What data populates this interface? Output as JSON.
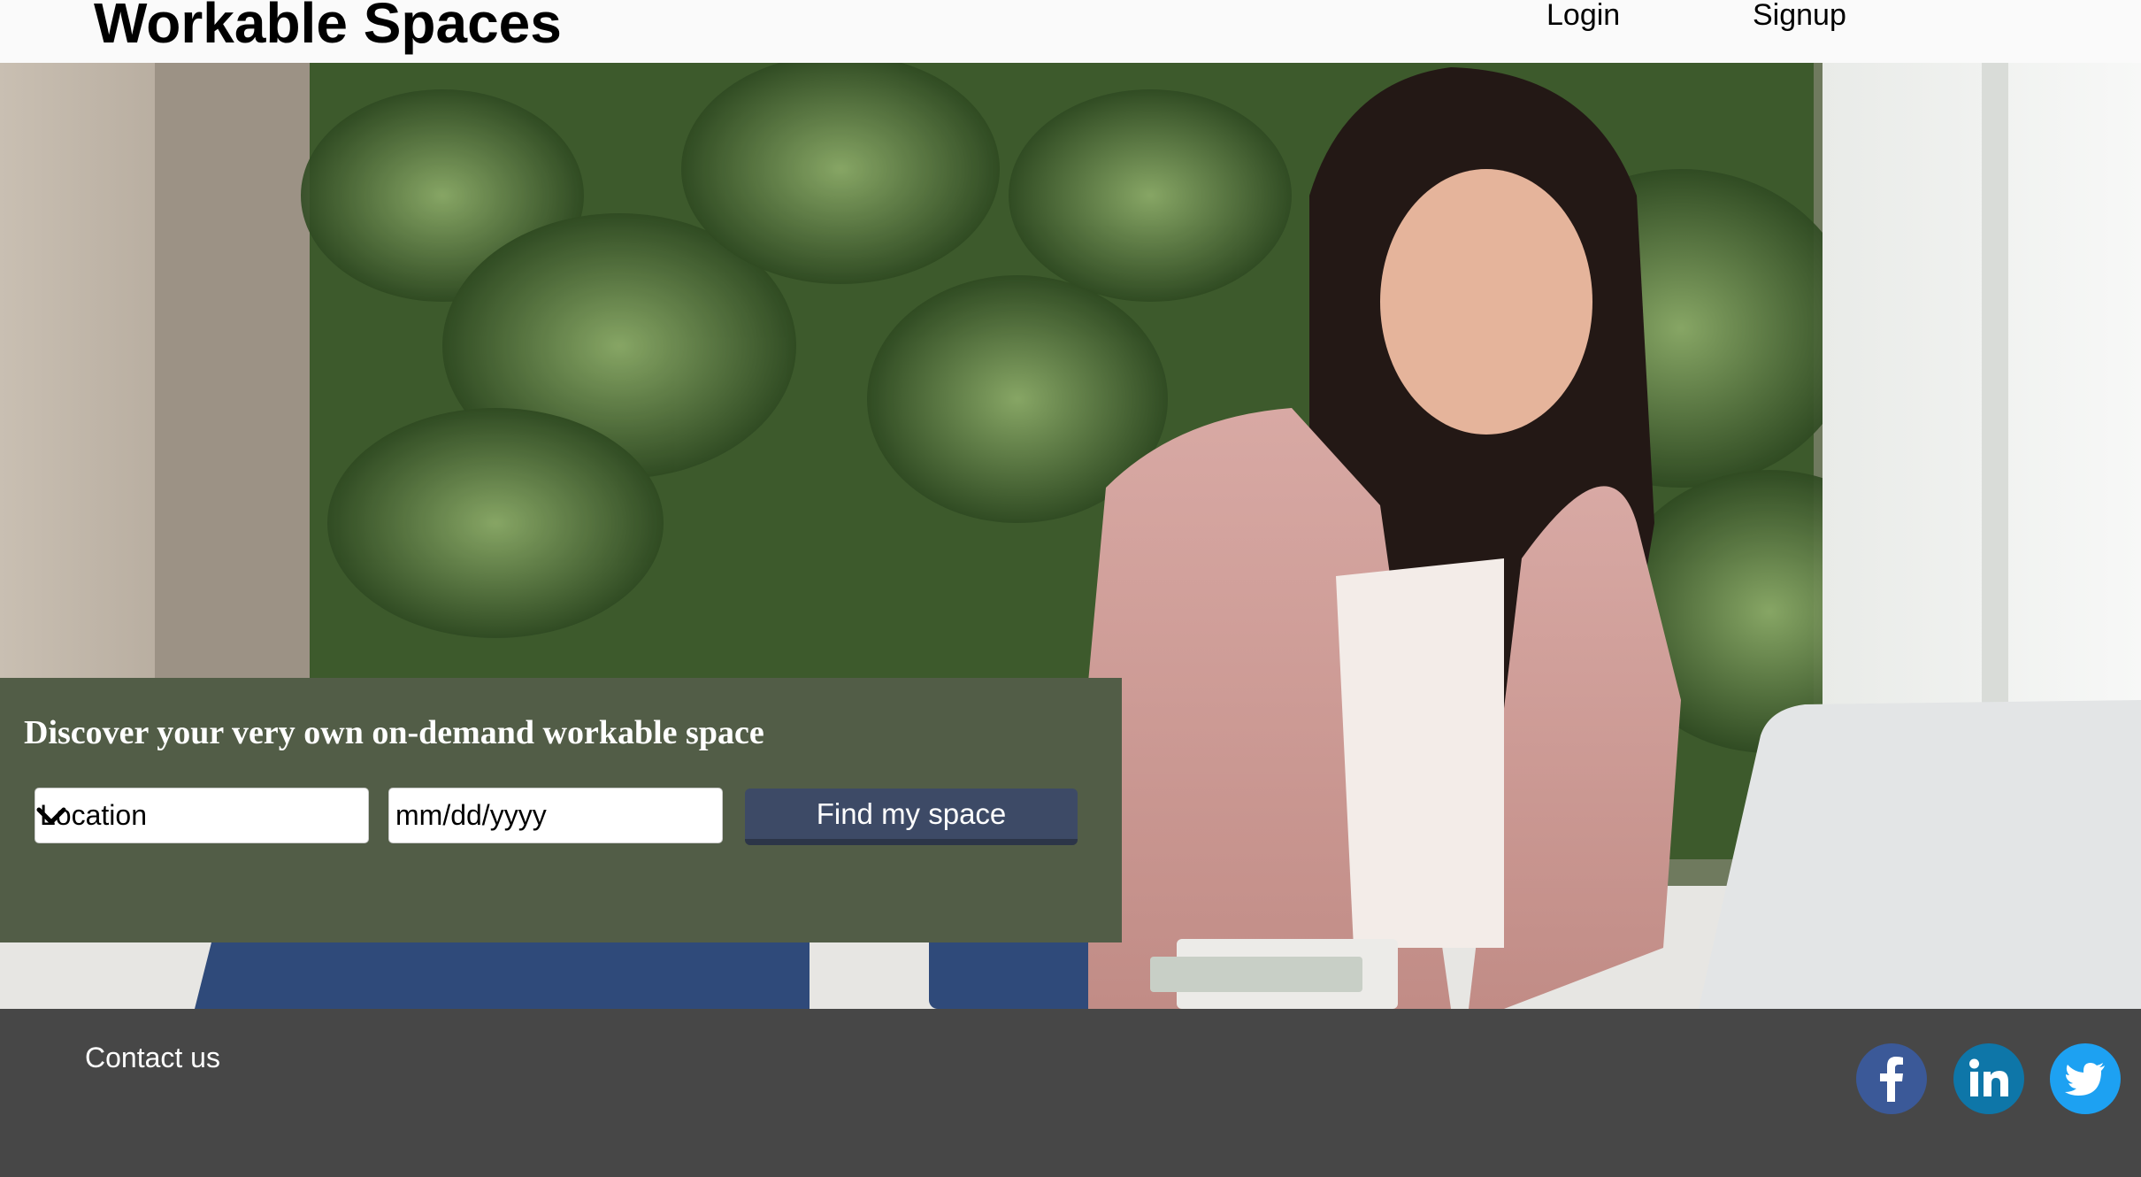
{
  "header": {
    "logo": "Workable Spaces",
    "nav": {
      "login": "Login",
      "signup": "Signup"
    }
  },
  "hero": {
    "tagline": "Discover your very own on-demand workable space",
    "location_select": {
      "value": "Location",
      "icon": "chevron-down-icon"
    },
    "date_input": {
      "placeholder": "mm/dd/yyyy"
    },
    "find_button": "Find my space"
  },
  "footer": {
    "contact": "Contact us",
    "social": [
      {
        "name": "facebook-icon",
        "color": "#3b5998"
      },
      {
        "name": "linkedin-icon",
        "color": "#0e76a8"
      },
      {
        "name": "twitter-icon",
        "color": "#1da1f2"
      }
    ]
  },
  "colors": {
    "search_panel": "#525d47",
    "button": "#3d4a66",
    "footer": "#474747"
  }
}
